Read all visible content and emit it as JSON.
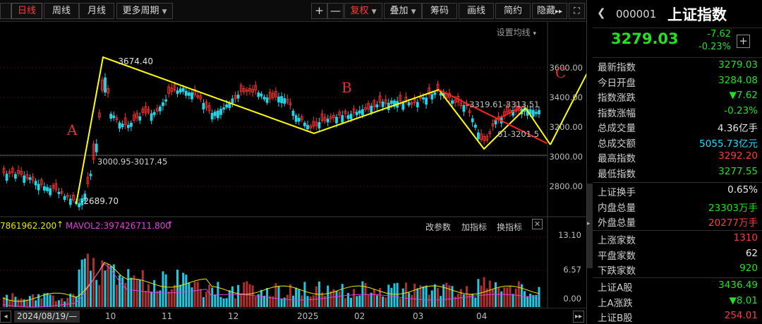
{
  "toolbar": {
    "tabs": [
      {
        "label": "日线",
        "active": true
      },
      {
        "label": "周线"
      },
      {
        "label": "月线"
      },
      {
        "label": "更多周期"
      }
    ],
    "plus": "+",
    "minus": "—",
    "restore": "复权",
    "overlay": "叠加",
    "chips": "筹码",
    "draw": "画线",
    "simple": "简约",
    "hide": "隐藏",
    "more": "▸▸"
  },
  "chart": {
    "setting_label": "设置均线",
    "indicator_mav1": "7861962.200",
    "indicator_mav2": "MAVOL2:397426711.800",
    "indicator_buttons": [
      "改参数",
      "加指标",
      "换指标"
    ],
    "close_x": "✕",
    "price_axis": [
      "3600.00",
      "3400.00",
      "3200.00",
      "3000.00",
      "2800.00"
    ],
    "vol_axis": [
      "13.10",
      "6.57",
      "0.00"
    ],
    "x_axis": [
      "2024/08/19/—",
      "10",
      "11",
      "12",
      "2025",
      "02",
      "03",
      "04"
    ],
    "annotations": {
      "high": "3674.40",
      "low": "2689.70",
      "gap1": "3000.95-3017.45",
      "gap2": "3319.61-3313.51",
      "gap3": "61-3201.5",
      "label_a": "A",
      "label_b": "B",
      "label_c": "C"
    }
  },
  "panel": {
    "code": "000001",
    "name": "上证指数",
    "price": "3279.03",
    "change": "-7.62",
    "change_pct": "-0.23%",
    "stats1": [
      {
        "label": "最新指数",
        "value": "3279.03",
        "color": "green"
      },
      {
        "label": "今日开盘",
        "value": "3284.08",
        "color": "green"
      },
      {
        "label": "指数涨跌",
        "value": "▼7.62",
        "color": "green"
      },
      {
        "label": "指数涨幅",
        "value": "-0.23%",
        "color": "green"
      },
      {
        "label": "总成交量",
        "value": "4.36亿手",
        "color": "white"
      },
      {
        "label": "总成交额",
        "value": "5055.73亿元",
        "color": "cyan"
      },
      {
        "label": "最高指数",
        "value": "3292.20",
        "color": "red"
      },
      {
        "label": "最低指数",
        "value": "3277.55",
        "color": "green"
      }
    ],
    "stats2": [
      {
        "label": "上证换手",
        "value": "0.65%",
        "color": "white"
      },
      {
        "label": "内盘总量",
        "value": "23303万手",
        "color": "green"
      },
      {
        "label": "外盘总量",
        "value": "20277万手",
        "color": "red"
      }
    ],
    "stats3": [
      {
        "label": "上涨家数",
        "value": "1310",
        "color": "red"
      },
      {
        "label": "平盘家数",
        "value": "62",
        "color": "white"
      },
      {
        "label": "下跌家数",
        "value": "920",
        "color": "green"
      }
    ],
    "stats4": [
      {
        "label": "上证A股",
        "value": "3436.49",
        "color": "green"
      },
      {
        "label": "上A涨跌",
        "value": "▼8.01",
        "color": "green"
      },
      {
        "label": "上证B股",
        "value": "254.01",
        "color": "red"
      }
    ]
  }
}
